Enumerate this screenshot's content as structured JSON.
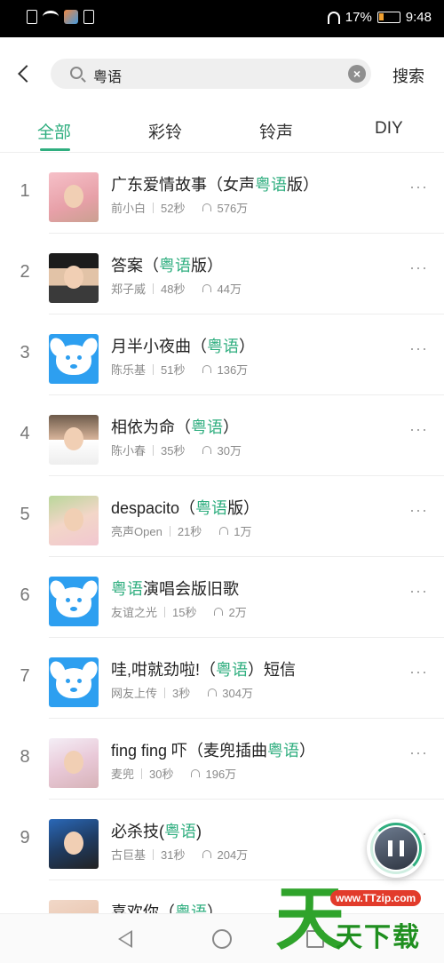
{
  "status_bar": {
    "battery": "17%",
    "time": "9:48"
  },
  "header": {
    "search_query": "粤语",
    "search_button": "搜索"
  },
  "tabs": [
    {
      "label": "全部",
      "active": true
    },
    {
      "label": "彩铃",
      "active": false
    },
    {
      "label": "铃声",
      "active": false
    },
    {
      "label": "DIY",
      "active": false
    }
  ],
  "songs": [
    {
      "rank": "1",
      "title_pre": "广东爱情故事（女声",
      "title_hl": "粤语",
      "title_post": "版）",
      "artist": "前小白",
      "duration": "52秒",
      "plays": "576万"
    },
    {
      "rank": "2",
      "title_pre": "答案（",
      "title_hl": "粤语",
      "title_post": "版）",
      "artist": "郑子威",
      "duration": "48秒",
      "plays": "44万"
    },
    {
      "rank": "3",
      "title_pre": "月半小夜曲（",
      "title_hl": "粤语",
      "title_post": "）",
      "artist": "陈乐基",
      "duration": "51秒",
      "plays": "136万"
    },
    {
      "rank": "4",
      "title_pre": "相依为命（",
      "title_hl": "粤语",
      "title_post": "）",
      "artist": "陈小春",
      "duration": "35秒",
      "plays": "30万"
    },
    {
      "rank": "5",
      "title_pre": "despacito（",
      "title_hl": "粤语",
      "title_post": "版）",
      "artist": "亮声Open",
      "duration": "21秒",
      "plays": "1万"
    },
    {
      "rank": "6",
      "title_pre": "",
      "title_hl": "粤语",
      "title_post": "演唱会版旧歌",
      "artist": "友谊之光",
      "duration": "15秒",
      "plays": "2万"
    },
    {
      "rank": "7",
      "title_pre": "哇,咁就劲啦!（",
      "title_hl": "粤语",
      "title_post": "）短信",
      "artist": "网友上传",
      "duration": "3秒",
      "plays": "304万"
    },
    {
      "rank": "8",
      "title_pre": "fing fing 吓（麦兜插曲",
      "title_hl": "粤语",
      "title_post": "）",
      "artist": "麦兜",
      "duration": "30秒",
      "plays": "196万"
    },
    {
      "rank": "9",
      "title_pre": "必杀技(",
      "title_hl": "粤语",
      "title_post": ")",
      "artist": "古巨基",
      "duration": "31秒",
      "plays": "204万"
    },
    {
      "rank": "",
      "title_pre": "喜欢你（",
      "title_hl": "粤语",
      "title_post": "）",
      "artist": "",
      "duration": "",
      "plays": ""
    }
  ],
  "more_label": "···",
  "watermark": {
    "big_char": "天",
    "url": "www.TTzip.com",
    "text": "天下载"
  },
  "colors": {
    "accent": "#2fae7f"
  }
}
